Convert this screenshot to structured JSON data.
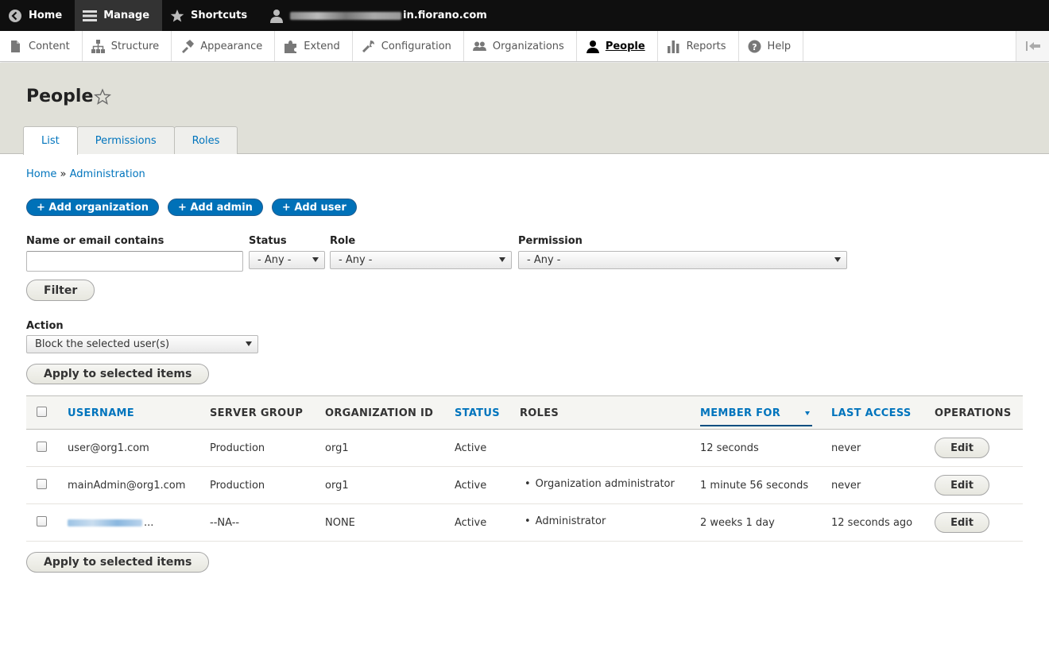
{
  "toolbar": {
    "home": "Home",
    "manage": "Manage",
    "shortcuts": "Shortcuts",
    "user_suffix": "in.fiorano.com"
  },
  "tray": {
    "items": [
      {
        "label": "Content",
        "icon": "file-icon"
      },
      {
        "label": "Structure",
        "icon": "sitemap-icon"
      },
      {
        "label": "Appearance",
        "icon": "brush-icon"
      },
      {
        "label": "Extend",
        "icon": "puzzle-icon"
      },
      {
        "label": "Configuration",
        "icon": "wrench-icon"
      },
      {
        "label": "Organizations",
        "icon": "group-icon"
      },
      {
        "label": "People",
        "icon": "person-icon"
      },
      {
        "label": "Reports",
        "icon": "bar-chart-icon"
      },
      {
        "label": "Help",
        "icon": "help-icon"
      }
    ],
    "active": "People"
  },
  "header": {
    "title": "People",
    "tabs": [
      "List",
      "Permissions",
      "Roles"
    ],
    "active_tab": "List"
  },
  "breadcrumb": {
    "home": "Home",
    "separator": "»",
    "admin": "Administration"
  },
  "actions": {
    "add_organization": "+ Add organization",
    "add_admin": "+ Add admin",
    "add_user": "+ Add user"
  },
  "filters": {
    "name_label": "Name or email contains",
    "name_value": "",
    "status_label": "Status",
    "status_value": "- Any -",
    "role_label": "Role",
    "role_value": "- Any -",
    "permission_label": "Permission",
    "permission_value": "- Any -",
    "filter_button": "Filter"
  },
  "bulk": {
    "action_label": "Action",
    "action_value": "Block the selected user(s)",
    "apply_button": "Apply to selected items"
  },
  "table": {
    "columns": [
      "USERNAME",
      "SERVER GROUP",
      "ORGANIZATION ID",
      "STATUS",
      "ROLES",
      "MEMBER FOR",
      "LAST ACCESS",
      "OPERATIONS"
    ],
    "rows": [
      {
        "username": "user@org1.com",
        "server_group": "Production",
        "org_id": "org1",
        "status": "Active",
        "roles": "",
        "member_for": "12 seconds",
        "last_access": "never",
        "op": "Edit"
      },
      {
        "username": "mainAdmin@org1.com",
        "server_group": "Production",
        "org_id": "org1",
        "status": "Active",
        "roles": "Organization administrator",
        "member_for": "1 minute 56 seconds",
        "last_access": "never",
        "op": "Edit"
      },
      {
        "username": "...",
        "server_group": "--NA--",
        "org_id": "NONE",
        "status": "Active",
        "roles": "Administrator",
        "member_for": "2 weeks 1 day",
        "last_access": "12 seconds ago",
        "op": "Edit"
      }
    ]
  },
  "colors": {
    "primary": "#0071b8",
    "link": "#0074bd",
    "toolbar": "#0f0f0f",
    "header_bg": "#e0e0d8"
  }
}
